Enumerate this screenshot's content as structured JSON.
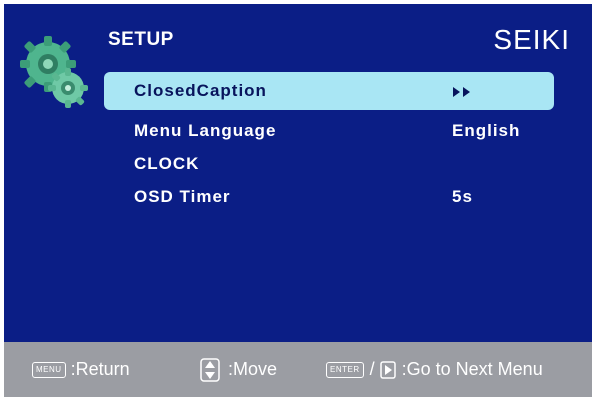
{
  "header": {
    "title": "SETUP",
    "brand": "SEIKI"
  },
  "menu": {
    "items": [
      {
        "label": "ClosedCaption",
        "value": "",
        "selected": true,
        "value_icon": "double-play-arrows-icon"
      },
      {
        "label": "Menu Language",
        "value": "English",
        "selected": false
      },
      {
        "label": "CLOCK",
        "value": "",
        "selected": false
      },
      {
        "label": "OSD Timer",
        "value": "5s",
        "selected": false
      }
    ]
  },
  "footer": {
    "menu_key": "MENU",
    "return_label": ":Return",
    "move_label": ":Move",
    "enter_key": "ENTER",
    "slash": "/",
    "next_label": ":Go to Next Menu"
  },
  "colors": {
    "background": "#0b1e86",
    "highlight": "#a9e6f4",
    "footer_bar": "#9b9da3",
    "text": "#ffffff"
  },
  "icons": {
    "setup": "gear-icon",
    "move": "up-down-icon",
    "next": "play-icon"
  }
}
